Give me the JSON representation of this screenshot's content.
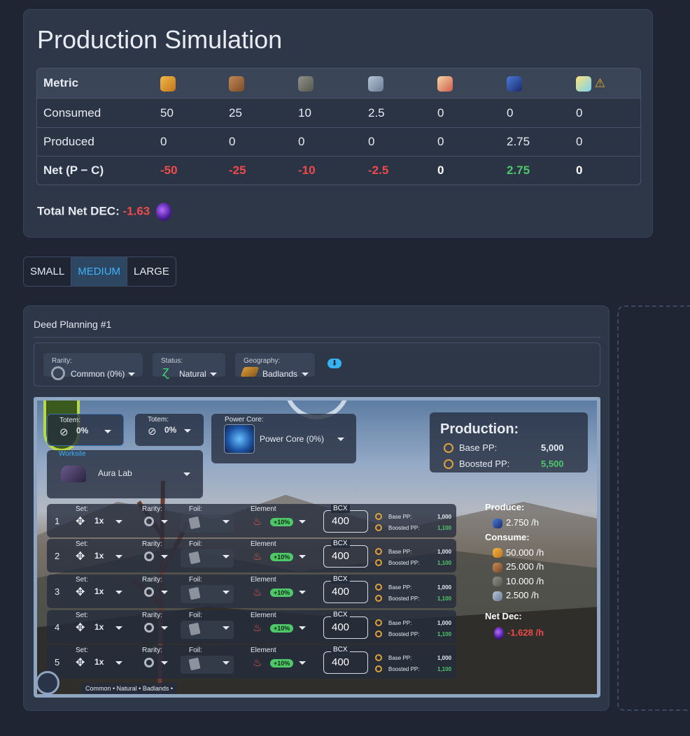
{
  "simulation": {
    "title": "Production Simulation",
    "table": {
      "header": "Metric",
      "resource_icons": [
        "grain-icon",
        "wood-icon",
        "stone-icon",
        "iron-icon",
        "research-icon",
        "aura-icon",
        "sps-icon"
      ],
      "warning_icon": "warning-icon",
      "rows": [
        {
          "label": "Consumed",
          "values": [
            "50",
            "25",
            "10",
            "2.5",
            "0",
            "0",
            "0"
          ]
        },
        {
          "label": "Produced",
          "values": [
            "0",
            "0",
            "0",
            "0",
            "0",
            "2.75",
            "0"
          ]
        },
        {
          "label": "Net (P − C)",
          "values": [
            "-50",
            "-25",
            "-10",
            "-2.5",
            "0",
            "2.75",
            "0"
          ]
        }
      ]
    },
    "total_label": "Total Net DEC:",
    "total_value": "-1.63"
  },
  "sizes": {
    "items": [
      "SMALL",
      "MEDIUM",
      "LARGE"
    ],
    "active": "MEDIUM"
  },
  "deed": {
    "title": "Deed Planning #1",
    "filters": {
      "rarity": {
        "label": "Rarity:",
        "value": "Common (0%)"
      },
      "status": {
        "label": "Status:",
        "value": "Natural"
      },
      "geography": {
        "label": "Geography:",
        "value": "Badlands"
      }
    },
    "totems": [
      {
        "label": "Totem:",
        "value": "0%"
      },
      {
        "label": "Totem:",
        "value": "0%"
      }
    ],
    "power_core": {
      "label": "Power Core:",
      "value": "Power Core (0%)"
    },
    "worksite": {
      "label": "Worksite",
      "value": "Aura Lab"
    },
    "production": {
      "title": "Production:",
      "base_label": "Base PP:",
      "base_value": "5,000",
      "boosted_label": "Boosted PP:",
      "boosted_value": "5,500"
    },
    "slot_labels": {
      "set": "Set:",
      "rarity": "Rarity:",
      "foil": "Foil:",
      "element": "Element",
      "bcx": "BCX",
      "base_pp": "Base PP:",
      "boosted_pp": "Boosted PP:"
    },
    "slots": [
      {
        "num": "1",
        "set": "1x",
        "element_boost": "+10%",
        "bcx": "400",
        "base_pp": "1,000",
        "boosted_pp": "1,100"
      },
      {
        "num": "2",
        "set": "1x",
        "element_boost": "+10%",
        "bcx": "400",
        "base_pp": "1,000",
        "boosted_pp": "1,100"
      },
      {
        "num": "3",
        "set": "1x",
        "element_boost": "+10%",
        "bcx": "400",
        "base_pp": "1,000",
        "boosted_pp": "1,100"
      },
      {
        "num": "4",
        "set": "1x",
        "element_boost": "+10%",
        "bcx": "400",
        "base_pp": "1,000",
        "boosted_pp": "1,100"
      },
      {
        "num": "5",
        "set": "1x",
        "element_boost": "+10%",
        "bcx": "400",
        "base_pp": "1,000",
        "boosted_pp": "1,100"
      }
    ],
    "produce": {
      "label": "Produce:",
      "items": [
        {
          "icon": "aura-icon",
          "value": "2.750 /h"
        }
      ]
    },
    "consume": {
      "label": "Consume:",
      "items": [
        {
          "icon": "grain-icon",
          "value": "50.000 /h"
        },
        {
          "icon": "wood-icon",
          "value": "25.000 /h"
        },
        {
          "icon": "stone-icon",
          "value": "10.000 /h"
        },
        {
          "icon": "iron-icon",
          "value": "2.500 /h"
        }
      ]
    },
    "net_dec": {
      "label": "Net Dec:",
      "value": "-1.628 /h"
    },
    "footer_tag": "Common • Natural • Badlands •"
  },
  "colors": {
    "negative": "#ef4a4a",
    "positive": "#4fc86a",
    "accent": "#3cb3ff"
  }
}
